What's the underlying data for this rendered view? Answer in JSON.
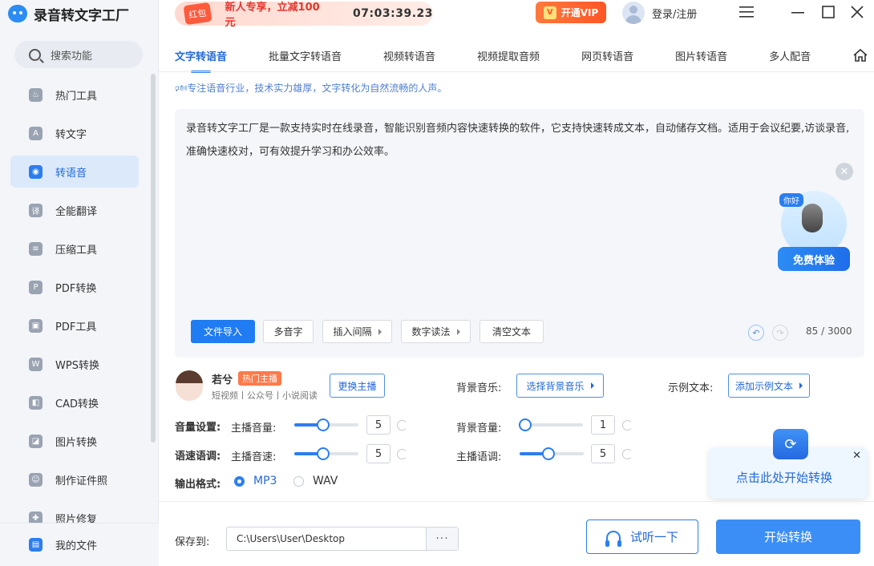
{
  "app": {
    "title": "录音转文字工厂"
  },
  "sidebar": {
    "search_label": "搜索功能",
    "items": [
      {
        "label": "热门工具",
        "icon": "flame-icon",
        "glyph": "♨"
      },
      {
        "label": "转文字",
        "icon": "text-convert-icon",
        "glyph": "A"
      },
      {
        "label": "转语音",
        "icon": "voice-icon",
        "glyph": "◉",
        "active": true
      },
      {
        "label": "全能翻译",
        "icon": "translate-icon",
        "glyph": "译"
      },
      {
        "label": "压缩工具",
        "icon": "compress-icon",
        "glyph": "≡"
      },
      {
        "label": "PDF转换",
        "icon": "pdf-convert-icon",
        "glyph": "P"
      },
      {
        "label": "PDF工具",
        "icon": "briefcase-icon",
        "glyph": "▣"
      },
      {
        "label": "WPS转换",
        "icon": "wps-icon",
        "glyph": "W"
      },
      {
        "label": "CAD转换",
        "icon": "cad-icon",
        "glyph": "◧"
      },
      {
        "label": "图片转换",
        "icon": "image-icon",
        "glyph": "◪"
      },
      {
        "label": "制作证件照",
        "icon": "id-photo-icon",
        "glyph": "☺"
      },
      {
        "label": "照片修复",
        "icon": "photo-repair-icon",
        "glyph": "✚"
      }
    ],
    "my_files": "我的文件"
  },
  "topbar": {
    "promo_badge": "红包",
    "promo_text": "新人专享，立减100元",
    "countdown": "07:03:39.23",
    "vip_label": "开通VIP",
    "vip_glyph": "V",
    "login_label": "登录/注册"
  },
  "tabs": [
    "文字转语音",
    "批量文字转语音",
    "视频转语音",
    "视频提取音频",
    "网页转语音",
    "图片转语音",
    "多人配音"
  ],
  "notice": "🕬专注语音行业，技术实力雄厚，文字转化为自然流畅的人声。",
  "editor": {
    "text": "录音转文字工厂是一款支持实时在线录音，智能识别音频内容快速转换的软件，它支持快速转成文本，自动储存文档。适用于会议纪要,访谈录音,准确快速校对，可有效提升学习和办公效率。",
    "promo_tag": "你好",
    "promo_button": "免费体验",
    "buttons": {
      "import": "文件导入",
      "polyphone": "多音字",
      "insert_pause": "插入间隔",
      "number_reading": "数字读法",
      "clear": "清空文本"
    },
    "counter": "85 / 3000"
  },
  "voice": {
    "name": "若兮",
    "tag": "热门主播",
    "subtitle": "短视频丨公众号丨小说阅读",
    "change_button": "更换主播",
    "bg_music_label": "背景音乐:",
    "bg_music_button": "选择背景音乐",
    "sample_label": "示例文本:",
    "sample_button": "添加示例文本"
  },
  "settings": {
    "volume_title": "音量设置:",
    "anchor_volume_label": "主播音量:",
    "anchor_volume": "5",
    "anchor_volume_level": 0.44,
    "bg_volume_label": "背景音量:",
    "bg_volume": "1",
    "bg_volume_level": 0.0,
    "speed_title": "语速语调:",
    "anchor_speed_label": "主播音速:",
    "anchor_speed": "5",
    "anchor_speed_level": 0.44,
    "anchor_pitch_label": "主播语调:",
    "anchor_pitch": "5",
    "anchor_pitch_level": 0.44,
    "format_title": "输出格式:",
    "formats": [
      "MP3",
      "WAV"
    ],
    "selected_format": "MP3"
  },
  "tip": {
    "text": "点击此处开始转换"
  },
  "footer": {
    "save_label": "保存到:",
    "save_path": "C:\\Users\\User\\Desktop",
    "more": "···",
    "listen_button": "试听一下",
    "start_button": "开始转换"
  },
  "colors": {
    "accent": "#2b7ef0",
    "promo_red": "#e5362f",
    "vip_orange": "#ff5627"
  }
}
